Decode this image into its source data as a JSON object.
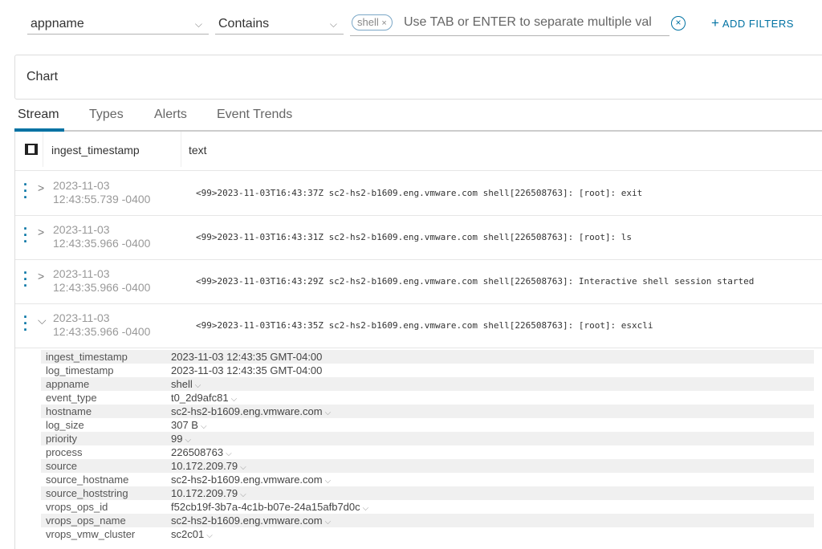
{
  "filter": {
    "field": "appname",
    "operator": "Contains",
    "tag": "shell",
    "placeholder": "Use TAB or ENTER to separate multiple val",
    "add_filters": "ADD FILTERS"
  },
  "chart_panel": {
    "title": "Chart"
  },
  "tabs": [
    "Stream",
    "Types",
    "Alerts",
    "Event Trends"
  ],
  "table": {
    "columns": [
      "ingest_timestamp",
      "text"
    ],
    "rows": [
      {
        "date": "2023-11-03",
        "time": "12:43:55.739 -0400",
        "text": "<99>2023-11-03T16:43:37Z sc2-hs2-b1609.eng.vmware.com shell[226508763]: [root]: exit",
        "expanded": false
      },
      {
        "date": "2023-11-03",
        "time": "12:43:35.966 -0400",
        "text": "<99>2023-11-03T16:43:31Z sc2-hs2-b1609.eng.vmware.com shell[226508763]: [root]: ls",
        "expanded": false
      },
      {
        "date": "2023-11-03",
        "time": "12:43:35.966 -0400",
        "text": "<99>2023-11-03T16:43:29Z sc2-hs2-b1609.eng.vmware.com shell[226508763]: Interactive shell session started",
        "expanded": false
      },
      {
        "date": "2023-11-03",
        "time": "12:43:35.966 -0400",
        "text": "<99>2023-11-03T16:43:35Z sc2-hs2-b1609.eng.vmware.com shell[226508763]: [root]: esxcli",
        "expanded": true
      }
    ]
  },
  "details": [
    {
      "k": "ingest_timestamp",
      "v": "2023-11-03 12:43:35 GMT-04:00",
      "dd": false
    },
    {
      "k": "log_timestamp",
      "v": "2023-11-03 12:43:35 GMT-04:00",
      "dd": false
    },
    {
      "k": "appname",
      "v": "shell",
      "dd": true
    },
    {
      "k": "event_type",
      "v": "t0_2d9afc81",
      "dd": true
    },
    {
      "k": "hostname",
      "v": "sc2-hs2-b1609.eng.vmware.com",
      "dd": true
    },
    {
      "k": "log_size",
      "v": "307 B",
      "dd": true
    },
    {
      "k": "priority",
      "v": "99",
      "dd": true
    },
    {
      "k": "process",
      "v": "226508763",
      "dd": true
    },
    {
      "k": "source",
      "v": "10.172.209.79",
      "dd": true
    },
    {
      "k": "source_hostname",
      "v": "sc2-hs2-b1609.eng.vmware.com",
      "dd": true
    },
    {
      "k": "source_hoststring",
      "v": "10.172.209.79",
      "dd": true
    },
    {
      "k": "vrops_ops_id",
      "v": "f52cb19f-3b7a-4c1b-b07e-24a15afb7d0c",
      "dd": true
    },
    {
      "k": "vrops_ops_name",
      "v": "sc2-hs2-b1609.eng.vmware.com",
      "dd": true
    },
    {
      "k": "vrops_vmw_cluster",
      "v": "sc2c01",
      "dd": true
    }
  ]
}
